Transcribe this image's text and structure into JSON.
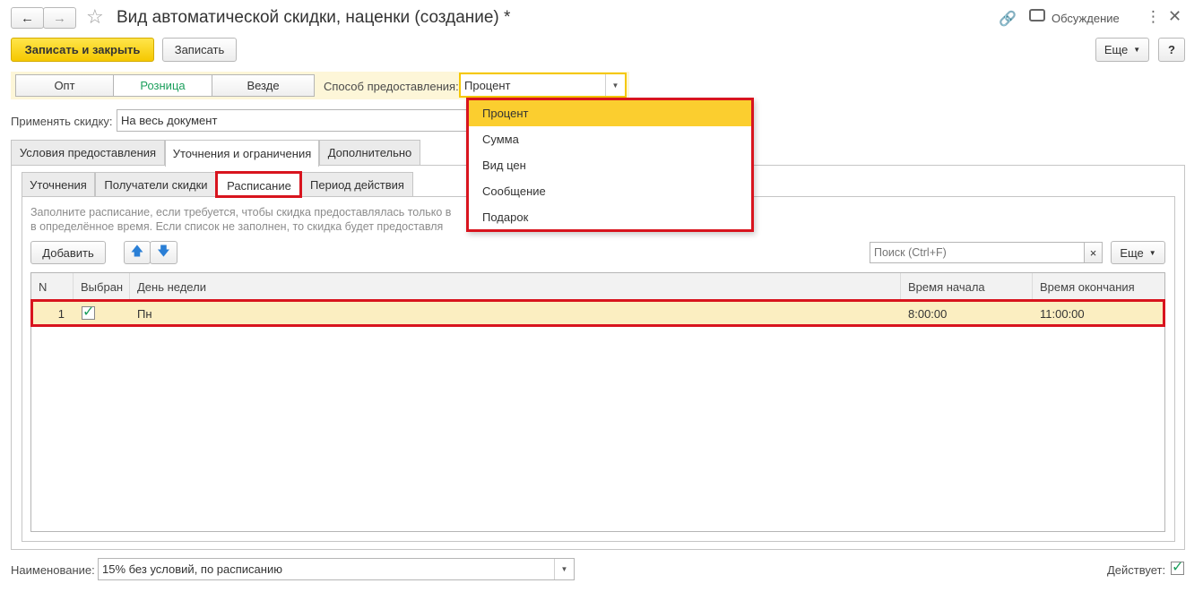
{
  "header": {
    "title": "Вид автоматической скидки, наценки (создание) *",
    "discussion_label": "Обсуждение"
  },
  "toolbar": {
    "save_close_label": "Записать и закрыть",
    "save_label": "Записать",
    "more_label": "Еще",
    "help_label": "?"
  },
  "segments": [
    {
      "label": "Опт"
    },
    {
      "label": "Розница",
      "active": true
    },
    {
      "label": "Везде"
    }
  ],
  "method": {
    "label": "Способ предоставления:",
    "value": "Процент"
  },
  "apply": {
    "label": "Применять скидку:",
    "value": "На весь документ"
  },
  "tabs": [
    "Условия предоставления",
    "Уточнения и ограничения",
    "Дополнительно"
  ],
  "subtabs": [
    "Уточнения",
    "Получатели скидки",
    "Расписание",
    "Период действия"
  ],
  "hint": {
    "line1": "Заполните расписание, если требуется, чтобы скидка предоставлялась только в",
    "line2": "в определённое время. Если список не заполнен, то скидка будет предоставля"
  },
  "table_toolbar": {
    "add_label": "Добавить",
    "search_placeholder": "Поиск (Ctrl+F)",
    "clear_icon": "×",
    "more_label": "Еще"
  },
  "table": {
    "columns": [
      "N",
      "Выбран",
      "День недели",
      "Время начала",
      "Время окончания"
    ],
    "rows": [
      {
        "n": "1",
        "selected": true,
        "day": "Пн",
        "start": "8:00:00",
        "end": "11:00:00"
      }
    ]
  },
  "dropdown": {
    "options": [
      "Процент",
      "Сумма",
      "Вид цен",
      "Сообщение",
      "Подарок"
    ],
    "selected": "Процент"
  },
  "footer": {
    "name_label": "Наименование:",
    "name_value": "15% без условий, по расписанию",
    "active_label": "Действует:",
    "active_checked": true
  },
  "colors": {
    "primary": "#f5c800",
    "highlight_row": "#fbeec1",
    "selected_option": "#fbce2f",
    "annotation_red": "#d8141e",
    "active_segment_text": "#1c9f5c"
  }
}
